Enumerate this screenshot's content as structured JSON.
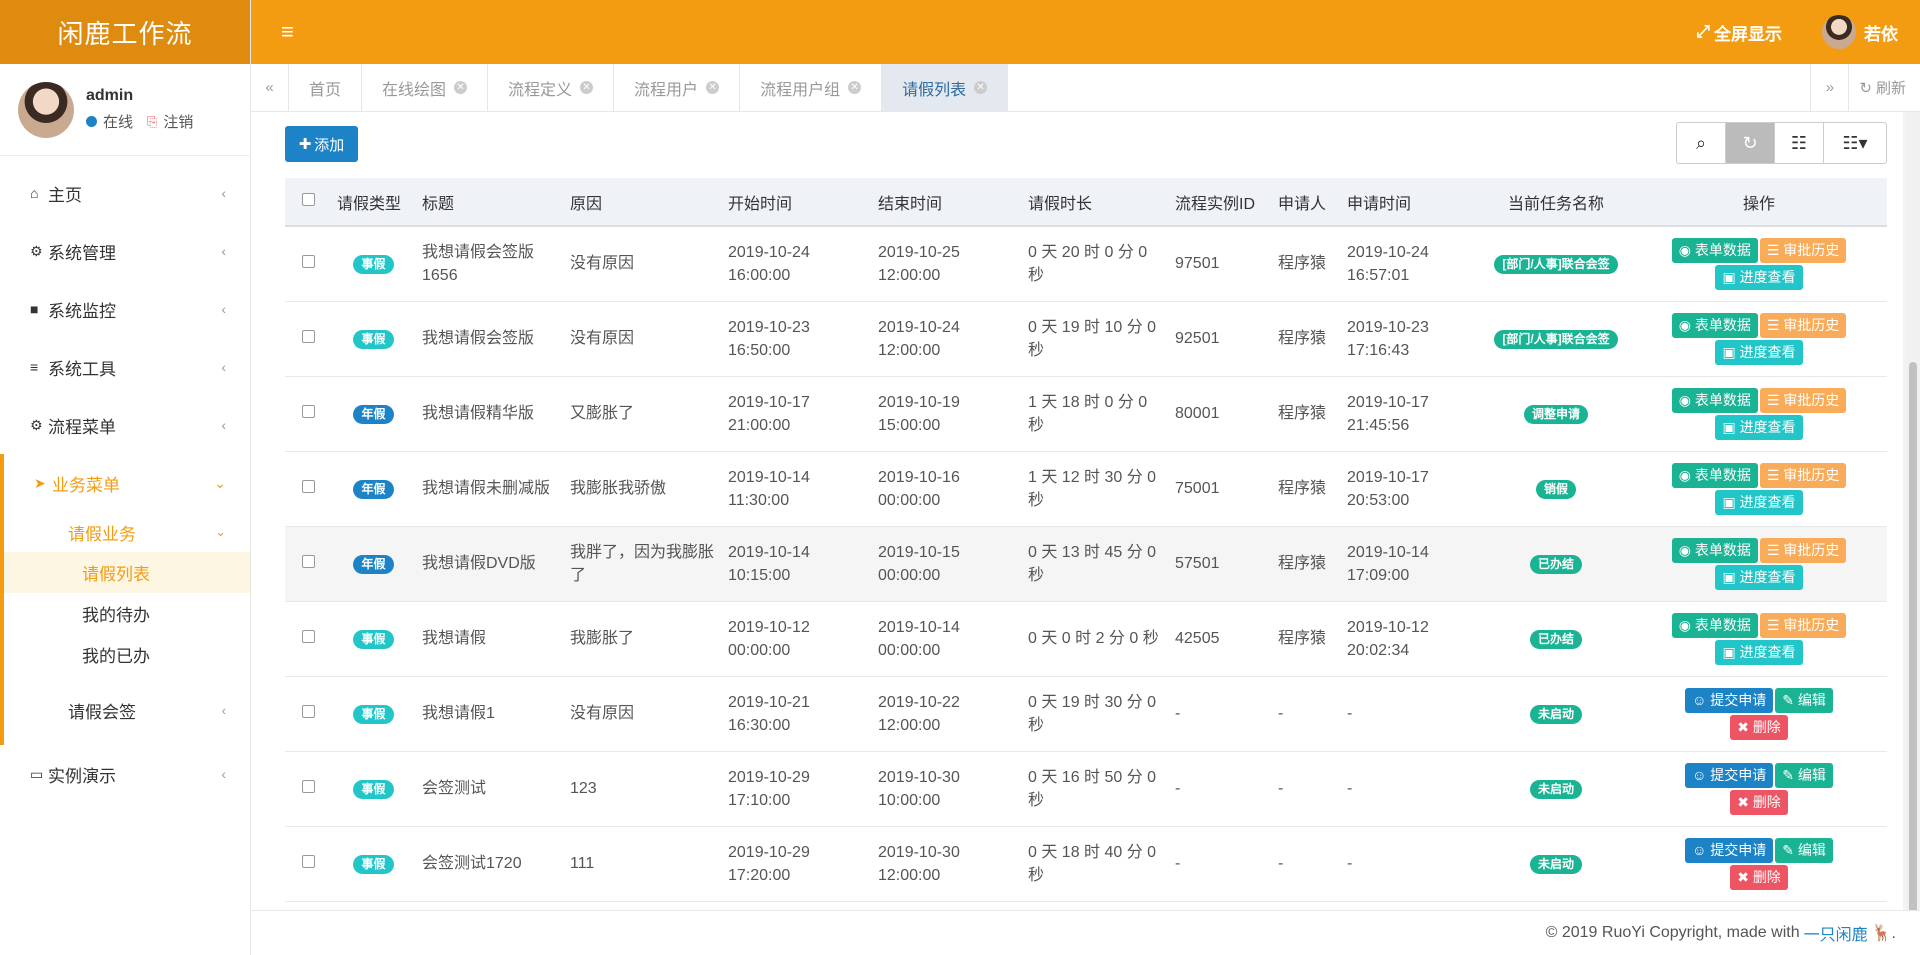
{
  "brand": "闲鹿工作流",
  "user": {
    "name": "admin",
    "status": "在线",
    "logout": "注销",
    "display_name": "若依"
  },
  "header": {
    "fullscreen": "全屏显示"
  },
  "sidebar": {
    "items": [
      {
        "label": "主页",
        "icon": "home-icon"
      },
      {
        "label": "系统管理",
        "icon": "gear-icon"
      },
      {
        "label": "系统监控",
        "icon": "video-camera-icon"
      },
      {
        "label": "系统工具",
        "icon": "bars-icon"
      },
      {
        "label": "流程菜单",
        "icon": "cogs-icon"
      }
    ],
    "active_group": {
      "label": "业务菜单",
      "icon": "paper-plane-icon",
      "sub_open": "请假业务",
      "children": [
        "请假列表",
        "我的待办",
        "我的已办"
      ],
      "sub_closed": "请假会签"
    },
    "last_item": {
      "label": "实例演示",
      "icon": "desktop-icon"
    }
  },
  "tabs": [
    {
      "label": "首页",
      "closable": false
    },
    {
      "label": "在线绘图",
      "closable": true
    },
    {
      "label": "流程定义",
      "closable": true
    },
    {
      "label": "流程用户",
      "closable": true
    },
    {
      "label": "流程用户组",
      "closable": true
    },
    {
      "label": "请假列表",
      "closable": true,
      "active": true
    }
  ],
  "refresh_label": "刷新",
  "toolbar": {
    "add_label": "添加"
  },
  "table": {
    "headers": [
      "请假类型",
      "标题",
      "原因",
      "开始时间",
      "结束时间",
      "请假时长",
      "流程实例ID",
      "申请人",
      "申请时间",
      "当前任务名称",
      "操作"
    ],
    "rows": [
      {
        "type": "事假",
        "title": "我想请假会签版1656",
        "reason": "没有原因",
        "start": "2019-10-24 16:00:00",
        "end": "2019-10-25 12:00:00",
        "duration": "0 天 20 时 0 分 0 秒",
        "pid": "97501",
        "applicant": "程序猿",
        "apply_time": "2019-10-24 16:57:01",
        "task": "[部门/人事]联合会签",
        "started": true
      },
      {
        "type": "事假",
        "title": "我想请假会签版",
        "reason": "没有原因",
        "start": "2019-10-23 16:50:00",
        "end": "2019-10-24 12:00:00",
        "duration": "0 天 19 时 10 分 0 秒",
        "pid": "92501",
        "applicant": "程序猿",
        "apply_time": "2019-10-23 17:16:43",
        "task": "[部门/人事]联合会签",
        "started": true
      },
      {
        "type": "年假",
        "title": "我想请假精华版",
        "reason": "又膨胀了",
        "start": "2019-10-17 21:00:00",
        "end": "2019-10-19 15:00:00",
        "duration": "1 天 18 时 0 分 0 秒",
        "pid": "80001",
        "applicant": "程序猿",
        "apply_time": "2019-10-17 21:45:56",
        "task": "调整申请",
        "started": true
      },
      {
        "type": "年假",
        "title": "我想请假未删减版",
        "reason": "我膨胀我骄傲",
        "start": "2019-10-14 11:30:00",
        "end": "2019-10-16 00:00:00",
        "duration": "1 天 12 时 30 分 0 秒",
        "pid": "75001",
        "applicant": "程序猿",
        "apply_time": "2019-10-17 20:53:00",
        "task": "销假",
        "started": true
      },
      {
        "type": "年假",
        "title": "我想请假DVD版",
        "reason": "我胖了，因为我膨胀了",
        "start": "2019-10-14 10:15:00",
        "end": "2019-10-15 00:00:00",
        "duration": "0 天 13 时 45 分 0 秒",
        "pid": "57501",
        "applicant": "程序猿",
        "apply_time": "2019-10-14 17:09:00",
        "task": "已办结",
        "started": true
      },
      {
        "type": "事假",
        "title": "我想请假",
        "reason": "我膨胀了",
        "start": "2019-10-12 00:00:00",
        "end": "2019-10-14 00:00:00",
        "duration": "0 天 0 时 2 分 0 秒",
        "pid": "42505",
        "applicant": "程序猿",
        "apply_time": "2019-10-12 20:02:34",
        "task": "已办结",
        "started": true
      },
      {
        "type": "事假",
        "title": "我想请假1",
        "reason": "没有原因",
        "start": "2019-10-21 16:30:00",
        "end": "2019-10-22 12:00:00",
        "duration": "0 天 19 时 30 分 0 秒",
        "pid": "-",
        "applicant": "-",
        "apply_time": "-",
        "task": "未启动",
        "started": false
      },
      {
        "type": "事假",
        "title": "会签测试",
        "reason": "123",
        "start": "2019-10-29 17:10:00",
        "end": "2019-10-30 10:00:00",
        "duration": "0 天 16 时 50 分 0 秒",
        "pid": "-",
        "applicant": "-",
        "apply_time": "-",
        "task": "未启动",
        "started": false
      },
      {
        "type": "事假",
        "title": "会签测试1720",
        "reason": "111",
        "start": "2019-10-29 17:20:00",
        "end": "2019-10-30 12:00:00",
        "duration": "0 天 18 时 40 分 0 秒",
        "pid": "-",
        "applicant": "-",
        "apply_time": "-",
        "task": "未启动",
        "started": false
      }
    ],
    "started_actions": [
      "表单数据",
      "审批历史",
      "进度查看"
    ],
    "draft_actions": [
      "提交申请",
      "编辑",
      "删除"
    ]
  },
  "footer": {
    "text": "© 2019 RuoYi Copyright, made with",
    "link": "一只闲鹿"
  },
  "colors": {
    "header": "#f39c12",
    "brand": "#df8b10",
    "primary": "#1c84c6",
    "success": "#1ab394",
    "info": "#23c6c8",
    "warning": "#f8ac59",
    "danger": "#ed5565"
  }
}
